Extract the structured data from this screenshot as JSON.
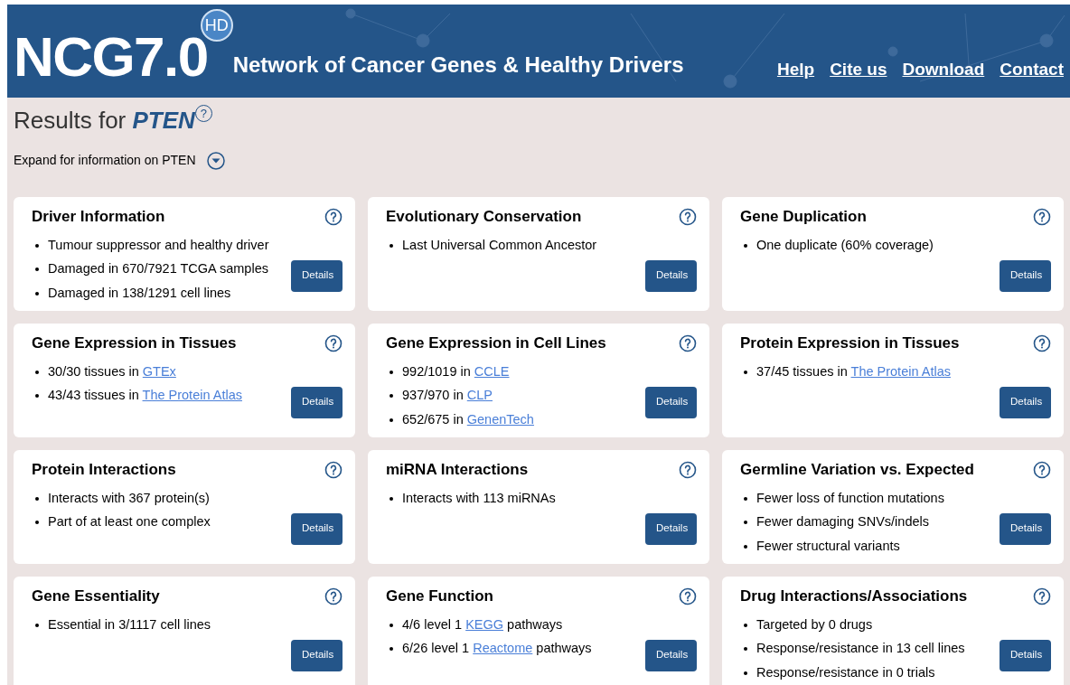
{
  "header": {
    "logo": "NCG7.0",
    "badge": "HD",
    "title": "Network of Cancer Genes & Healthy Drivers",
    "links": [
      "Help",
      "Cite us",
      "Download",
      "Contact"
    ]
  },
  "results": {
    "label": "Results for",
    "gene": "PTEN",
    "help": "?"
  },
  "expand": {
    "label": "Expand for information on PTEN",
    "expanded": false
  },
  "cards": [
    {
      "title": "Driver Information",
      "button": "Details",
      "items": [
        {
          "text": "Tumour suppressor and healthy driver"
        },
        {
          "text": "Damaged in 670/7921 TCGA samples"
        },
        {
          "text": "Damaged in 138/1291 cell lines"
        }
      ]
    },
    {
      "title": "Evolutionary Conservation",
      "button": "Details",
      "items": [
        {
          "text": "Last Universal Common Ancestor"
        }
      ]
    },
    {
      "title": "Gene Duplication",
      "button": "Details",
      "items": [
        {
          "text": "One duplicate (60% coverage)"
        }
      ]
    },
    {
      "title": "Gene Expression in Tissues",
      "button": "Details",
      "items": [
        {
          "text": "30/30 tissues in ",
          "link": "GTEx"
        },
        {
          "text": "43/43 tissues in ",
          "link": "The Protein Atlas"
        }
      ]
    },
    {
      "title": "Gene Expression in Cell Lines",
      "button": "Details",
      "items": [
        {
          "text": "992/1019 in ",
          "link": "CCLE"
        },
        {
          "text": "937/970 in ",
          "link": "CLP"
        },
        {
          "text": "652/675 in ",
          "link": "GenenTech"
        }
      ]
    },
    {
      "title": "Protein Expression in Tissues",
      "button": "Details",
      "items": [
        {
          "text": "37/45 tissues in ",
          "link": "The Protein Atlas"
        }
      ]
    },
    {
      "title": "Protein Interactions",
      "button": "Details",
      "items": [
        {
          "text": "Interacts with 367 protein(s)"
        },
        {
          "text": "Part of at least one complex"
        }
      ]
    },
    {
      "title": "miRNA Interactions",
      "button": "Details",
      "items": [
        {
          "text": "Interacts with 113 miRNAs"
        }
      ]
    },
    {
      "title": "Germline Variation vs. Expected",
      "button": "Details",
      "items": [
        {
          "text": "Fewer loss of function mutations"
        },
        {
          "text": "Fewer damaging SNVs/indels"
        },
        {
          "text": "Fewer structural variants"
        }
      ]
    },
    {
      "title": "Gene Essentiality",
      "button": "Details",
      "items": [
        {
          "text": "Essential in 3/1117 cell lines"
        }
      ]
    },
    {
      "title": "Gene Function",
      "button": "Details",
      "items": [
        {
          "text": "4/6 level 1 ",
          "link": "KEGG",
          "after": " pathways"
        },
        {
          "text": "6/26 level 1 ",
          "link": "Reactome",
          "after": " pathways"
        }
      ]
    },
    {
      "title": "Drug Interactions/Associations",
      "button": "Details",
      "items": [
        {
          "text": "Targeted by 0 drugs"
        },
        {
          "text": "Response/resistance in 13 cell lines"
        },
        {
          "text": "Response/resistance in 0 trials"
        }
      ]
    }
  ]
}
